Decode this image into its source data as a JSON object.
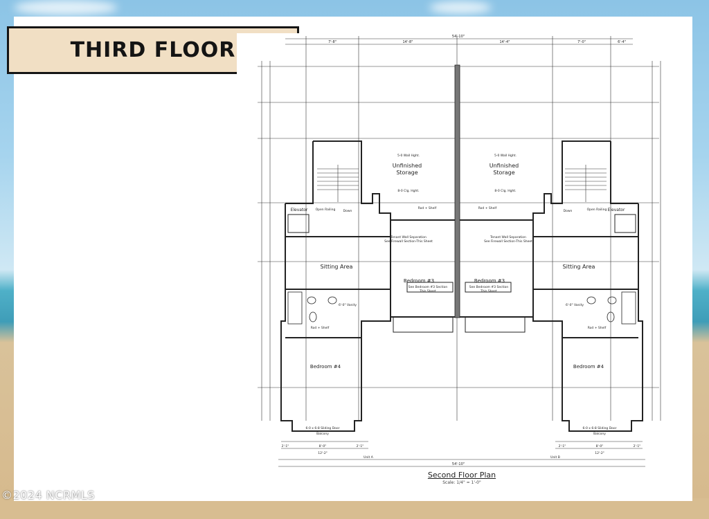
{
  "header": {
    "title": "Third Floor"
  },
  "watermark": {
    "text": "©2024 NCRMLS"
  },
  "floor_plan": {
    "title": "Second Floor Plan",
    "scale": "Scale: 1/4\" = 1'-0\"",
    "overall_width": "54'-10\"",
    "rooms": {
      "storage_left": [
        "Unfinished",
        "Storage"
      ],
      "storage_right": [
        "Unfinished",
        "Storage"
      ],
      "sitting_left": "Sitting Area",
      "sitting_right": "Sitting Area",
      "bedroom3_left": "Bedroom #3",
      "bedroom3_right": "Bedroom #3",
      "bedroom4_left": "Bedroom #4",
      "bedroom4_right": "Bedroom #4",
      "elevator_left": "Elevator",
      "elevator_right": "Elevator",
      "vanity": "6'-0\" Vanity",
      "rod_shelf": "Rod + Shelf",
      "open_railing": "Open Railing",
      "down": "Down",
      "sliding_door": "6-0 x 6-8 Sliding Door",
      "balcony": "Balcony",
      "tenant_sep": [
        "Tenant Wall Separation",
        "See Firewall Section-This Sheet"
      ],
      "wall_hgt": "5-0 Wall Hght.",
      "clg_hgt": "8-0 Clg. Hght.",
      "see_bedroom": [
        "See Bedroom #3 Section",
        "This Sheet"
      ]
    },
    "dims_top": [
      "7'-8\"",
      "14'-8\"",
      "14'-4\"",
      "7'-0\"",
      "6'-4\""
    ],
    "dims_bottom_left": [
      "2'-1\"",
      "8'-0\"",
      "2'-1\"",
      "12'-2\""
    ],
    "dims_bottom_right": [
      "2'-1\"",
      "8'-0\"",
      "2'-1\"",
      "12'-2\""
    ],
    "unit_left": "Unit A",
    "unit_right": "Unit B"
  }
}
